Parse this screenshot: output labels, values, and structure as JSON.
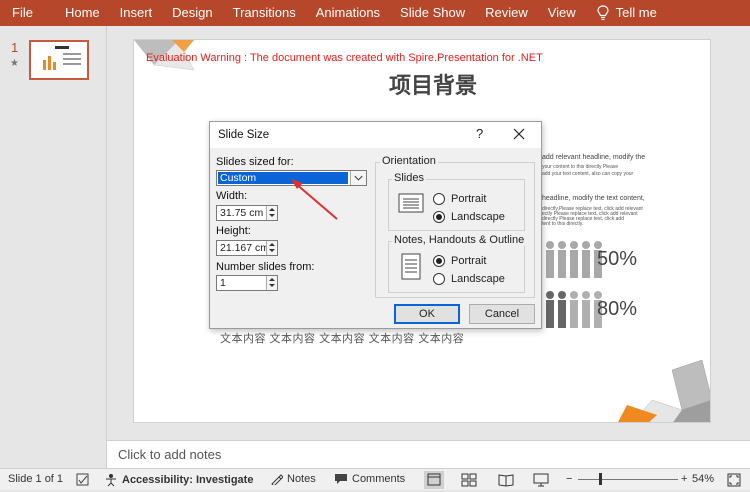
{
  "ribbon": {
    "tabs": [
      "File",
      "Home",
      "Insert",
      "Design",
      "Transitions",
      "Animations",
      "Slide Show",
      "Review",
      "View"
    ],
    "tell_me": "Tell me",
    "background": "#b7472a"
  },
  "thumbnails": {
    "slide_number": "1",
    "star": "★"
  },
  "slide": {
    "warning": "Evaluation Warning : The document was created with  Spire.Presentation for .NET",
    "title": "项目背景",
    "text_right_1": "add relevant headline, modify the",
    "text_right_2": "your content to this   directly Please",
    "text_right_3": "add your text content, also can copy your",
    "text_right_4": "headline, modify the text content,",
    "text_right_5": "directly,Please replace text, click add relevant",
    "text_right_6": "ectly Please replace text, click add relevant",
    "text_right_7": "directly Please replace text, click add",
    "text_right_8": "tent to this directly.",
    "percent_1": "50%",
    "percent_2": "80%",
    "bottom_cjk": "文本内容  文本内容  文本内容  文本内容  文本内容"
  },
  "dialog": {
    "title": "Slide Size",
    "help": "?",
    "sized_for_label": "Slides sized for:",
    "sized_for_value": "Custom",
    "width_label": "Width:",
    "width_value": "31.75 cm",
    "height_label": "Height:",
    "height_value": "21.167 cm",
    "number_from_label": "Number slides from:",
    "number_from_value": "1",
    "orientation_label": "Orientation",
    "slides_group": "Slides",
    "notes_group": "Notes, Handouts & Outline",
    "portrait": "Portrait",
    "landscape": "Landscape",
    "ok": "OK",
    "cancel": "Cancel",
    "slides_orientation": "Landscape",
    "notes_orientation": "Portrait"
  },
  "notes_bar": {
    "placeholder": "Click to add notes"
  },
  "status": {
    "slide_of": "Slide 1 of 1",
    "accessibility": "Accessibility: Investigate",
    "notes": "Notes",
    "comments": "Comments",
    "zoom_minus": "−",
    "zoom_plus": "+",
    "zoom": "54%"
  },
  "colors": {
    "accent": "#b7472a",
    "warning": "#e2211c",
    "selection": "#0a64d8",
    "arrow": "#e0302a"
  }
}
